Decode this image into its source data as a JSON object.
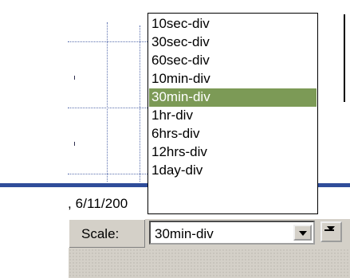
{
  "chart": {
    "date_label": ", 6/11/200"
  },
  "controls": {
    "scale_label": "Scale:",
    "scale_value": "30min-div"
  },
  "dropdown": {
    "options": [
      "10sec-div",
      "30sec-div",
      "60sec-div",
      "10min-div",
      "30min-div",
      "1hr-div",
      "6hrs-div",
      "12hrs-div",
      "1day-div"
    ],
    "selected": "30min-div"
  },
  "colors": {
    "selection": "#7c9a56",
    "axis_band": "#2f4d9a",
    "panel": "#d4d0c8",
    "grid_dots": "#5a6fae"
  },
  "icons": [
    "combo-dropdown-arrow-icon",
    "side-dropdown-arrow-icon"
  ]
}
